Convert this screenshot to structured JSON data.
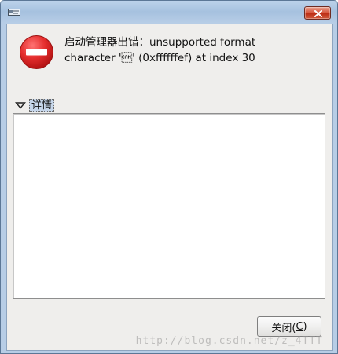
{
  "window": {
    "title_icon": "app-window-icon",
    "close_icon": "close-icon"
  },
  "error": {
    "icon": "error-stop-icon",
    "message_line1": "启动管理器出错：unsupported format",
    "message_line2": "character '\u0018' (0xffffffef) at index 30"
  },
  "details": {
    "toggle_icon": "disclosure-triangle-icon",
    "label": "详情",
    "content": ""
  },
  "actions": {
    "close_label_prefix": "关闭(",
    "close_mnemonic": "C",
    "close_label_suffix": ")"
  },
  "watermark": {
    "text": "http://blog.csdn.net/z_4TTT"
  },
  "colors": {
    "title_bar": "#b7cde6",
    "client_background": "#efeeec",
    "close_button": "#c83b20",
    "error_red": "#d92525",
    "details_highlight": "#c6d6ea"
  }
}
